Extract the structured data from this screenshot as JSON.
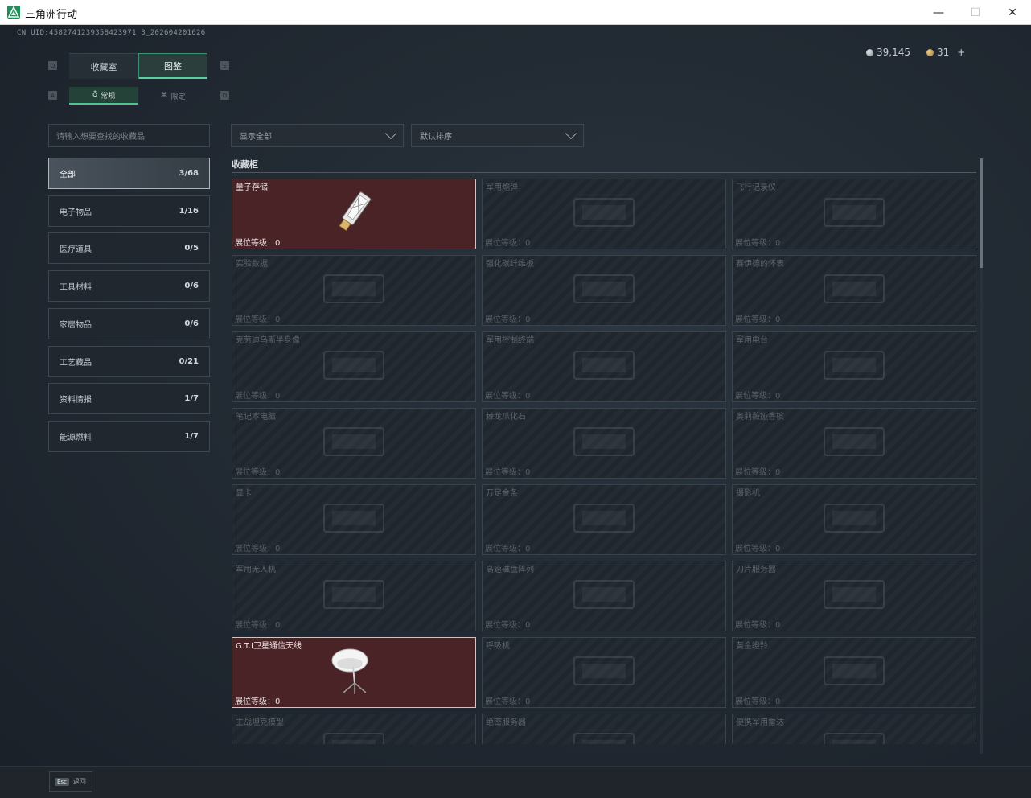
{
  "window": {
    "title": "三角洲行动",
    "minimize": "—",
    "maximize": "☐",
    "close": "✕"
  },
  "uid": "CN UID:4582741239358423971 3_202604201626",
  "currency": {
    "silver": "39,145",
    "gold": "31",
    "add": "+"
  },
  "tabs_main": {
    "left_key": "Q",
    "right_key": "E",
    "items": [
      "收藏室",
      "图鉴"
    ],
    "active": 1
  },
  "tabs_sub": {
    "left_key": "A",
    "right_key": "D",
    "items": [
      "常规",
      "限定"
    ],
    "active": 0
  },
  "search": {
    "placeholder": "请输入想要查找的收藏品"
  },
  "categories": [
    {
      "label": "全部",
      "count": "3/68"
    },
    {
      "label": "电子物品",
      "count": "1/16"
    },
    {
      "label": "医疗道具",
      "count": "0/5"
    },
    {
      "label": "工具材料",
      "count": "0/6"
    },
    {
      "label": "家居物品",
      "count": "0/6"
    },
    {
      "label": "工艺藏品",
      "count": "0/21"
    },
    {
      "label": "资料情报",
      "count": "1/7"
    },
    {
      "label": "能源燃料",
      "count": "1/7"
    }
  ],
  "filters": {
    "show": "显示全部",
    "sort": "默认排序"
  },
  "section": {
    "title": "收藏柜"
  },
  "level_label": "展位等级：",
  "items": [
    {
      "name": "量子存储",
      "level": "0",
      "unlocked": true,
      "icon": "usb-drive-icon"
    },
    {
      "name": "军用炮弹",
      "level": "0",
      "unlocked": false,
      "icon": "shell-icon"
    },
    {
      "name": "飞行记录仪",
      "level": "0",
      "unlocked": false,
      "icon": "recorder-icon"
    },
    {
      "name": "实验数据",
      "level": "0",
      "unlocked": false,
      "icon": "disc-icon"
    },
    {
      "name": "强化碳纤维板",
      "level": "0",
      "unlocked": false,
      "icon": "plate-icon"
    },
    {
      "name": "赛伊德的怀表",
      "level": "0",
      "unlocked": false,
      "icon": "watch-icon"
    },
    {
      "name": "克劳迪乌斯半身像",
      "level": "0",
      "unlocked": false,
      "icon": "bust-icon"
    },
    {
      "name": "军用控制终端",
      "level": "0",
      "unlocked": false,
      "icon": "terminal-icon"
    },
    {
      "name": "军用电台",
      "level": "0",
      "unlocked": false,
      "icon": "radio-icon"
    },
    {
      "name": "笔记本电脑",
      "level": "0",
      "unlocked": false,
      "icon": "laptop-icon"
    },
    {
      "name": "棘龙爪化石",
      "level": "0",
      "unlocked": false,
      "icon": "fossil-icon"
    },
    {
      "name": "奥莉薇娅香槟",
      "level": "0",
      "unlocked": false,
      "icon": "bottle-icon"
    },
    {
      "name": "显卡",
      "level": "0",
      "unlocked": false,
      "icon": "gpu-icon"
    },
    {
      "name": "万足金条",
      "level": "0",
      "unlocked": false,
      "icon": "gold-bar-icon"
    },
    {
      "name": "摄影机",
      "level": "0",
      "unlocked": false,
      "icon": "camera-icon"
    },
    {
      "name": "军用无人机",
      "level": "0",
      "unlocked": false,
      "icon": "drone-icon"
    },
    {
      "name": "高速磁盘阵列",
      "level": "0",
      "unlocked": false,
      "icon": "disk-array-icon"
    },
    {
      "name": "刀片服务器",
      "level": "0",
      "unlocked": false,
      "icon": "server-icon"
    },
    {
      "name": "G.T.I卫星通信天线",
      "level": "0",
      "unlocked": true,
      "icon": "satellite-dish-icon"
    },
    {
      "name": "呼吸机",
      "level": "0",
      "unlocked": false,
      "icon": "ventilator-icon"
    },
    {
      "name": "黄金瞪羚",
      "level": "0",
      "unlocked": false,
      "icon": "gazelle-icon"
    },
    {
      "name": "主战坦克模型",
      "level": "",
      "unlocked": false,
      "icon": "tank-icon"
    },
    {
      "name": "绝密服务器",
      "level": "",
      "unlocked": false,
      "icon": "server-icon"
    },
    {
      "name": "便携军用雷达",
      "level": "",
      "unlocked": false,
      "icon": "radar-icon"
    }
  ],
  "footer": {
    "key": "Esc",
    "label": "返回"
  }
}
